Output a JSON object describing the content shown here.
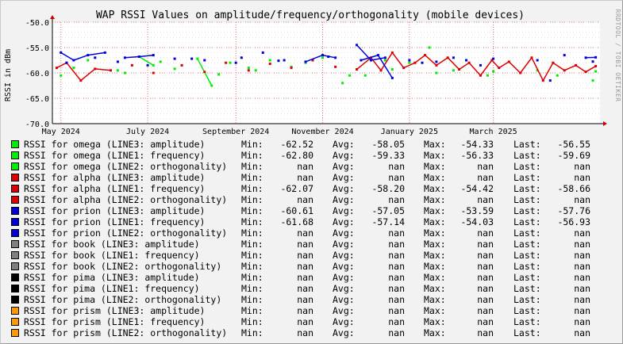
{
  "chart_data": {
    "type": "line",
    "title": "WAP RSSI Values on amplitude/frequency/orthogonality (mobile devices)",
    "ylabel": "RSSI in dBm",
    "watermark": "RRDTOOL / TOBI OETIKER",
    "ylim": [
      -70.0,
      -50.0
    ],
    "y_ticks": [
      "-50.0",
      "-55.0",
      "-60.0",
      "-65.0",
      "-70.0"
    ],
    "x_range": [
      "2024-04-25",
      "2025-05-15"
    ],
    "x_ticks": [
      {
        "label": "May 2024",
        "date": "2024-05-01"
      },
      {
        "label": "July 2024",
        "date": "2024-07-01"
      },
      {
        "label": "September 2024",
        "date": "2024-09-01"
      },
      {
        "label": "November 2024",
        "date": "2024-11-01"
      },
      {
        "label": "January 2025",
        "date": "2025-01-01"
      },
      {
        "label": "March 2025",
        "date": "2025-03-01"
      }
    ],
    "series": [
      {
        "name": "omega (LINE3: amplitude)",
        "color": "#00ee00",
        "points": [
          [
            "2024-05-01",
            -60.5
          ],
          [
            "2024-05-20",
            -57.5
          ],
          [
            "2024-06-10",
            -59.5
          ],
          [
            "2024-06-25",
            -56.8
          ],
          [
            "2024-07-05",
            -58.5
          ],
          [
            "2024-07-20",
            -59.2
          ],
          [
            "2024-08-05",
            -57.2
          ],
          [
            "2024-08-15",
            -62.5
          ],
          [
            "2024-08-28",
            -58.0
          ],
          [
            "2024-09-10",
            -59.0
          ],
          [
            "2024-09-25",
            -57.5
          ],
          [
            "2024-10-10",
            -58.8
          ],
          [
            "2024-11-01",
            -57.0
          ],
          [
            "2024-11-15",
            -62.0
          ],
          [
            "2024-12-01",
            -60.5
          ],
          [
            "2024-12-15",
            -57.5
          ],
          [
            "2025-01-01",
            -58.0
          ],
          [
            "2025-01-15",
            -55.0
          ],
          [
            "2025-02-01",
            -59.5
          ],
          [
            "2025-02-25",
            -60.5
          ],
          [
            "2025-04-15",
            -60.5
          ],
          [
            "2025-05-10",
            -61.5
          ]
        ]
      },
      {
        "name": "omega (LINE1: frequency)",
        "color": "#00ee00",
        "points": [
          [
            "2024-05-10",
            -59.0
          ],
          [
            "2024-06-15",
            -60.0
          ],
          [
            "2024-07-10",
            -57.8
          ],
          [
            "2024-08-20",
            -60.3
          ],
          [
            "2024-09-15",
            -59.5
          ],
          [
            "2024-10-20",
            -58.0
          ],
          [
            "2024-11-20",
            -60.5
          ],
          [
            "2024-12-20",
            -59.3
          ],
          [
            "2025-01-20",
            -60.0
          ],
          [
            "2025-03-01",
            -59.7
          ],
          [
            "2025-04-01",
            -59.5
          ],
          [
            "2025-05-12",
            -59.7
          ]
        ]
      },
      {
        "name": "alpha (LINE3: amplitude)",
        "color": "#dd0000",
        "points": []
      },
      {
        "name": "alpha (LINE1: frequency)",
        "color": "#dd0000",
        "points": [
          [
            "2024-04-28",
            -59.0
          ],
          [
            "2024-05-05",
            -58.0
          ],
          [
            "2024-05-15",
            -61.5
          ],
          [
            "2024-05-25",
            -59.2
          ],
          [
            "2024-06-05",
            -59.5
          ],
          [
            "2024-06-20",
            -58.5
          ],
          [
            "2024-07-05",
            -60.0
          ],
          [
            "2024-07-25",
            -58.5
          ],
          [
            "2024-08-10",
            -59.8
          ],
          [
            "2024-08-25",
            -58.0
          ],
          [
            "2024-09-10",
            -59.5
          ],
          [
            "2024-09-25",
            -58.2
          ],
          [
            "2024-10-10",
            -59.0
          ],
          [
            "2024-10-25",
            -57.5
          ],
          [
            "2024-11-10",
            -58.8
          ],
          [
            "2024-11-25",
            -59.3
          ],
          [
            "2024-12-05",
            -57.0
          ],
          [
            "2024-12-12",
            -59.5
          ],
          [
            "2024-12-20",
            -56.0
          ],
          [
            "2024-12-28",
            -59.0
          ],
          [
            "2025-01-05",
            -58.0
          ],
          [
            "2025-01-12",
            -56.5
          ],
          [
            "2025-01-20",
            -58.5
          ],
          [
            "2025-01-28",
            -57.0
          ],
          [
            "2025-02-05",
            -59.3
          ],
          [
            "2025-02-12",
            -58.0
          ],
          [
            "2025-02-20",
            -60.5
          ],
          [
            "2025-02-28",
            -57.5
          ],
          [
            "2025-03-05",
            -59.0
          ],
          [
            "2025-03-12",
            -57.8
          ],
          [
            "2025-03-20",
            -60.0
          ],
          [
            "2025-03-28",
            -57.0
          ],
          [
            "2025-04-05",
            -61.5
          ],
          [
            "2025-04-12",
            -58.0
          ],
          [
            "2025-04-20",
            -59.5
          ],
          [
            "2025-04-28",
            -58.5
          ],
          [
            "2025-05-05",
            -59.8
          ],
          [
            "2025-05-12",
            -58.66
          ]
        ]
      },
      {
        "name": "alpha (LINE2: orthogonality)",
        "color": "#dd0000",
        "points": []
      },
      {
        "name": "prion (LINE3: amplitude)",
        "color": "#0000dd",
        "points": [
          [
            "2024-05-01",
            -56.0
          ],
          [
            "2024-05-10",
            -57.5
          ],
          [
            "2024-05-20",
            -56.5
          ],
          [
            "2024-06-01",
            -56.0
          ],
          [
            "2024-06-15",
            -57.0
          ],
          [
            "2024-06-25",
            -56.8
          ],
          [
            "2024-07-05",
            -56.5
          ],
          [
            "2024-07-20",
            -57.2
          ],
          [
            "2024-08-10",
            -57.5
          ],
          [
            "2024-09-05",
            -57.0
          ],
          [
            "2024-09-20",
            -56.0
          ],
          [
            "2024-10-05",
            -57.5
          ],
          [
            "2024-10-20",
            -57.8
          ],
          [
            "2024-11-01",
            -56.5
          ],
          [
            "2024-11-10",
            -57.0
          ],
          [
            "2024-11-25",
            -54.5
          ],
          [
            "2024-12-05",
            -57.5
          ],
          [
            "2024-12-15",
            -57.0
          ],
          [
            "2025-01-01",
            -57.5
          ],
          [
            "2025-01-20",
            -57.8
          ],
          [
            "2025-02-10",
            -57.5
          ],
          [
            "2025-03-01",
            -57.2
          ],
          [
            "2025-04-01",
            -57.5
          ],
          [
            "2025-04-20",
            -56.5
          ],
          [
            "2025-05-10",
            -57.76
          ]
        ]
      },
      {
        "name": "prion (LINE1: frequency)",
        "color": "#0000dd",
        "points": [
          [
            "2024-05-05",
            -58.0
          ],
          [
            "2024-05-25",
            -57.0
          ],
          [
            "2024-06-10",
            -57.8
          ],
          [
            "2024-07-01",
            -58.5
          ],
          [
            "2024-08-01",
            -57.2
          ],
          [
            "2024-09-01",
            -58.0
          ],
          [
            "2024-10-01",
            -57.6
          ],
          [
            "2024-11-05",
            -56.8
          ],
          [
            "2024-11-28",
            -57.5
          ],
          [
            "2024-12-10",
            -56.5
          ],
          [
            "2024-12-20",
            -61.0
          ],
          [
            "2025-01-10",
            -58.0
          ],
          [
            "2025-02-01",
            -57.0
          ],
          [
            "2025-02-20",
            -58.5
          ],
          [
            "2025-04-10",
            -61.5
          ],
          [
            "2025-05-05",
            -57.0
          ],
          [
            "2025-05-12",
            -56.93
          ]
        ]
      }
    ]
  },
  "legend": {
    "captions": {
      "min": "Min:",
      "avg": "Avg:",
      "max": "Max:",
      "last": "Last:"
    },
    "rows": [
      {
        "label": "RSSI for omega (LINE3: amplitude)",
        "color": "#00ee00",
        "min": "-62.52",
        "avg": "-58.05",
        "max": "-54.33",
        "last": "-56.55"
      },
      {
        "label": "RSSI for omega (LINE1: frequency)",
        "color": "#00ee00",
        "min": "-62.80",
        "avg": "-59.33",
        "max": "-56.33",
        "last": "-59.69"
      },
      {
        "label": "RSSI for omega (LINE2: orthogonality)",
        "color": "#00ee00",
        "min": "nan",
        "avg": "nan",
        "max": "nan",
        "last": "nan"
      },
      {
        "label": "RSSI for alpha (LINE3: amplitude)",
        "color": "#dd0000",
        "min": "nan",
        "avg": "nan",
        "max": "nan",
        "last": "nan"
      },
      {
        "label": "RSSI for alpha (LINE1: frequency)",
        "color": "#dd0000",
        "min": "-62.07",
        "avg": "-58.20",
        "max": "-54.42",
        "last": "-58.66"
      },
      {
        "label": "RSSI for alpha (LINE2: orthogonality)",
        "color": "#dd0000",
        "min": "nan",
        "avg": "nan",
        "max": "nan",
        "last": "nan"
      },
      {
        "label": "RSSI for prion (LINE3: amplitude)",
        "color": "#0000dd",
        "min": "-60.61",
        "avg": "-57.05",
        "max": "-53.59",
        "last": "-57.76"
      },
      {
        "label": "RSSI for prion (LINE1: frequency)",
        "color": "#0000dd",
        "min": "-61.68",
        "avg": "-57.14",
        "max": "-54.03",
        "last": "-56.93"
      },
      {
        "label": "RSSI for prion (LINE2: orthogonality)",
        "color": "#0000dd",
        "min": "nan",
        "avg": "nan",
        "max": "nan",
        "last": "nan"
      },
      {
        "label": "RSSI for book (LINE3: amplitude)",
        "color": "#808080",
        "min": "nan",
        "avg": "nan",
        "max": "nan",
        "last": "nan"
      },
      {
        "label": "RSSI for book (LINE1: frequency)",
        "color": "#808080",
        "min": "nan",
        "avg": "nan",
        "max": "nan",
        "last": "nan"
      },
      {
        "label": "RSSI for book (LINE2: orthogonality)",
        "color": "#808080",
        "min": "nan",
        "avg": "nan",
        "max": "nan",
        "last": "nan"
      },
      {
        "label": "RSSI for pima (LINE3: amplitude)",
        "color": "#000000",
        "min": "nan",
        "avg": "nan",
        "max": "nan",
        "last": "nan"
      },
      {
        "label": "RSSI for pima (LINE1: frequency)",
        "color": "#000000",
        "min": "nan",
        "avg": "nan",
        "max": "nan",
        "last": "nan"
      },
      {
        "label": "RSSI for pima (LINE2: orthogonality)",
        "color": "#000000",
        "min": "nan",
        "avg": "nan",
        "max": "nan",
        "last": "nan"
      },
      {
        "label": "RSSI for prism (LINE3: amplitude)",
        "color": "#ff9900",
        "min": "nan",
        "avg": "nan",
        "max": "nan",
        "last": "nan"
      },
      {
        "label": "RSSI for prism (LINE1: frequency)",
        "color": "#ff9900",
        "min": "nan",
        "avg": "nan",
        "max": "nan",
        "last": "nan"
      },
      {
        "label": "RSSI for prism (LINE2: orthogonality)",
        "color": "#ff9900",
        "min": "nan",
        "avg": "nan",
        "max": "nan",
        "last": "nan"
      }
    ]
  }
}
